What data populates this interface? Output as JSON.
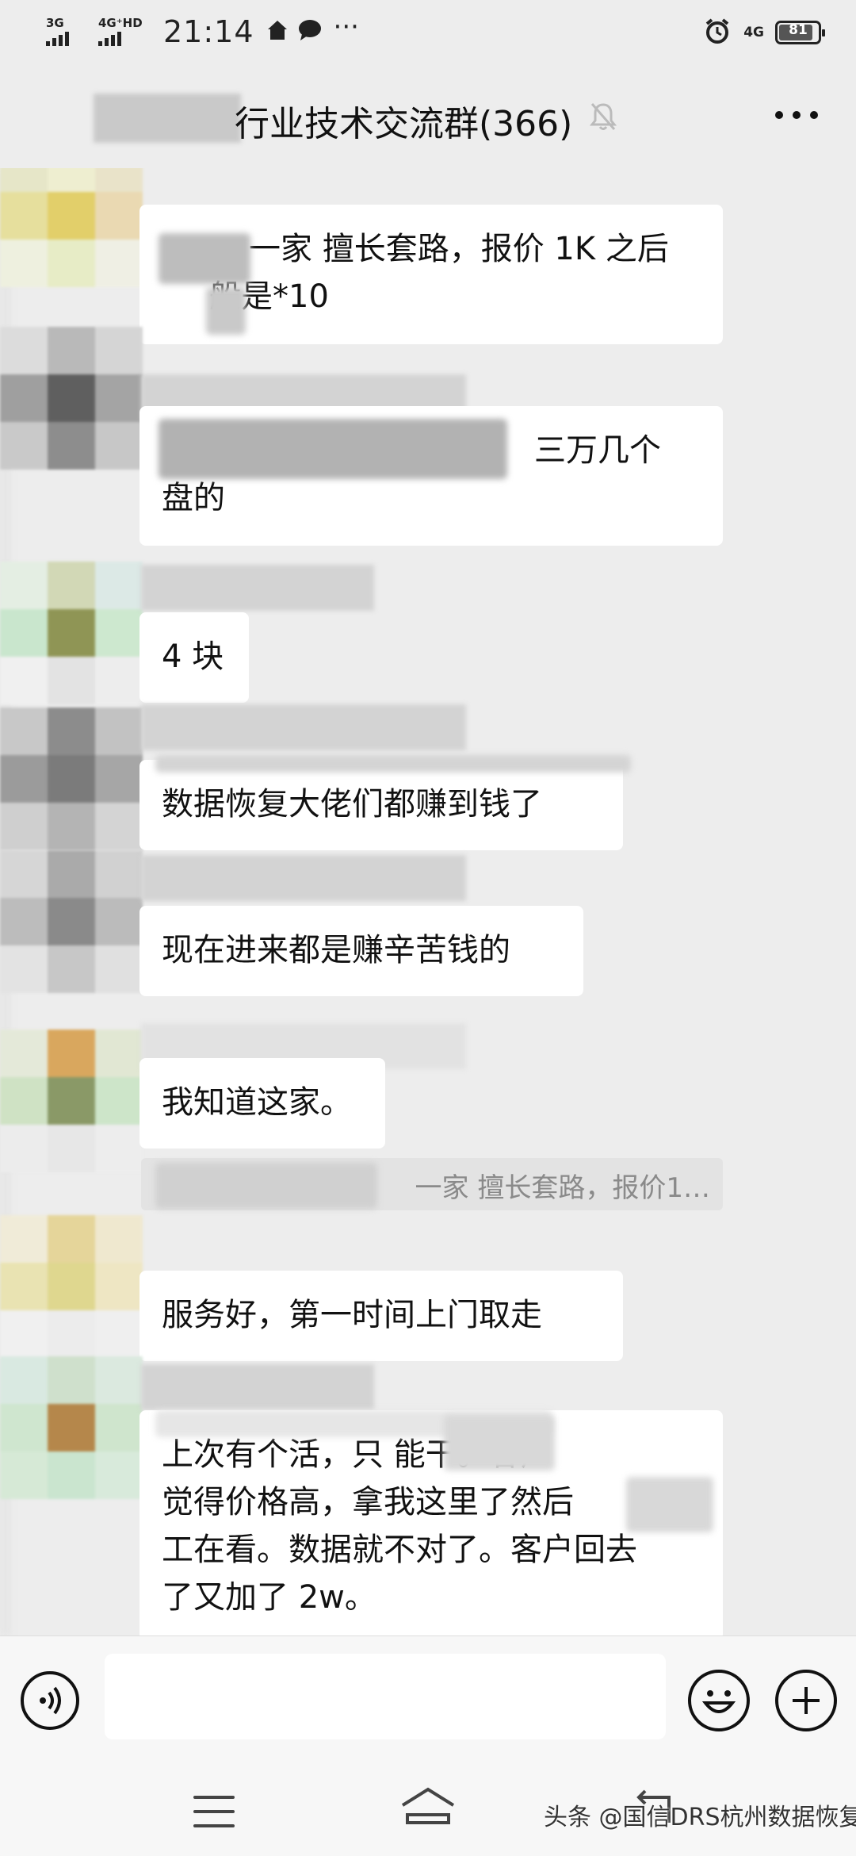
{
  "status_bar": {
    "sim1_label": "3G",
    "sim2_label": "4G⁺HD",
    "time": "21:14",
    "more_glyph": "···",
    "network_label": "4G",
    "battery_level": "81"
  },
  "header": {
    "group_title": "行业技术交流群(366)",
    "mute_icon": "bell-muted-icon",
    "more_icon": "more-dots-icon"
  },
  "messages": [
    {
      "id": 1,
      "text_visible": "一家 擅长套路，报价 1K  之后",
      "line2": "般是*10"
    },
    {
      "id": 2,
      "line1_visible": "三万几个",
      "line2": "盘的"
    },
    {
      "id": 3,
      "text": "4 块"
    },
    {
      "id": 4,
      "text": "数据恢复大佬们都赚到钱了"
    },
    {
      "id": 5,
      "text": "现在进来都是赚辛苦钱的"
    },
    {
      "id": 6,
      "text": "我知道这家。"
    },
    {
      "id": 7,
      "quote": "一家 擅长套路，报价1…"
    },
    {
      "id": 8,
      "text": "服务好，第一时间上门取走"
    },
    {
      "id": 9,
      "lines": [
        "上次有个活，只      能干。客户",
        "觉得价格高，拿我这里了然后",
        "工在看。数据就不对了。客户回去",
        "了又加了 2w。"
      ]
    }
  ],
  "input_bar": {
    "placeholder": "",
    "voice_icon": "voice-icon",
    "emoji_icon": "emoji-icon",
    "plus_icon": "plus-icon"
  },
  "nav_bar": {
    "menu_icon": "menu-icon",
    "home_icon": "home-icon",
    "back_icon": "back-icon"
  },
  "watermark": "头条 @国信DRS杭州数据恢复"
}
